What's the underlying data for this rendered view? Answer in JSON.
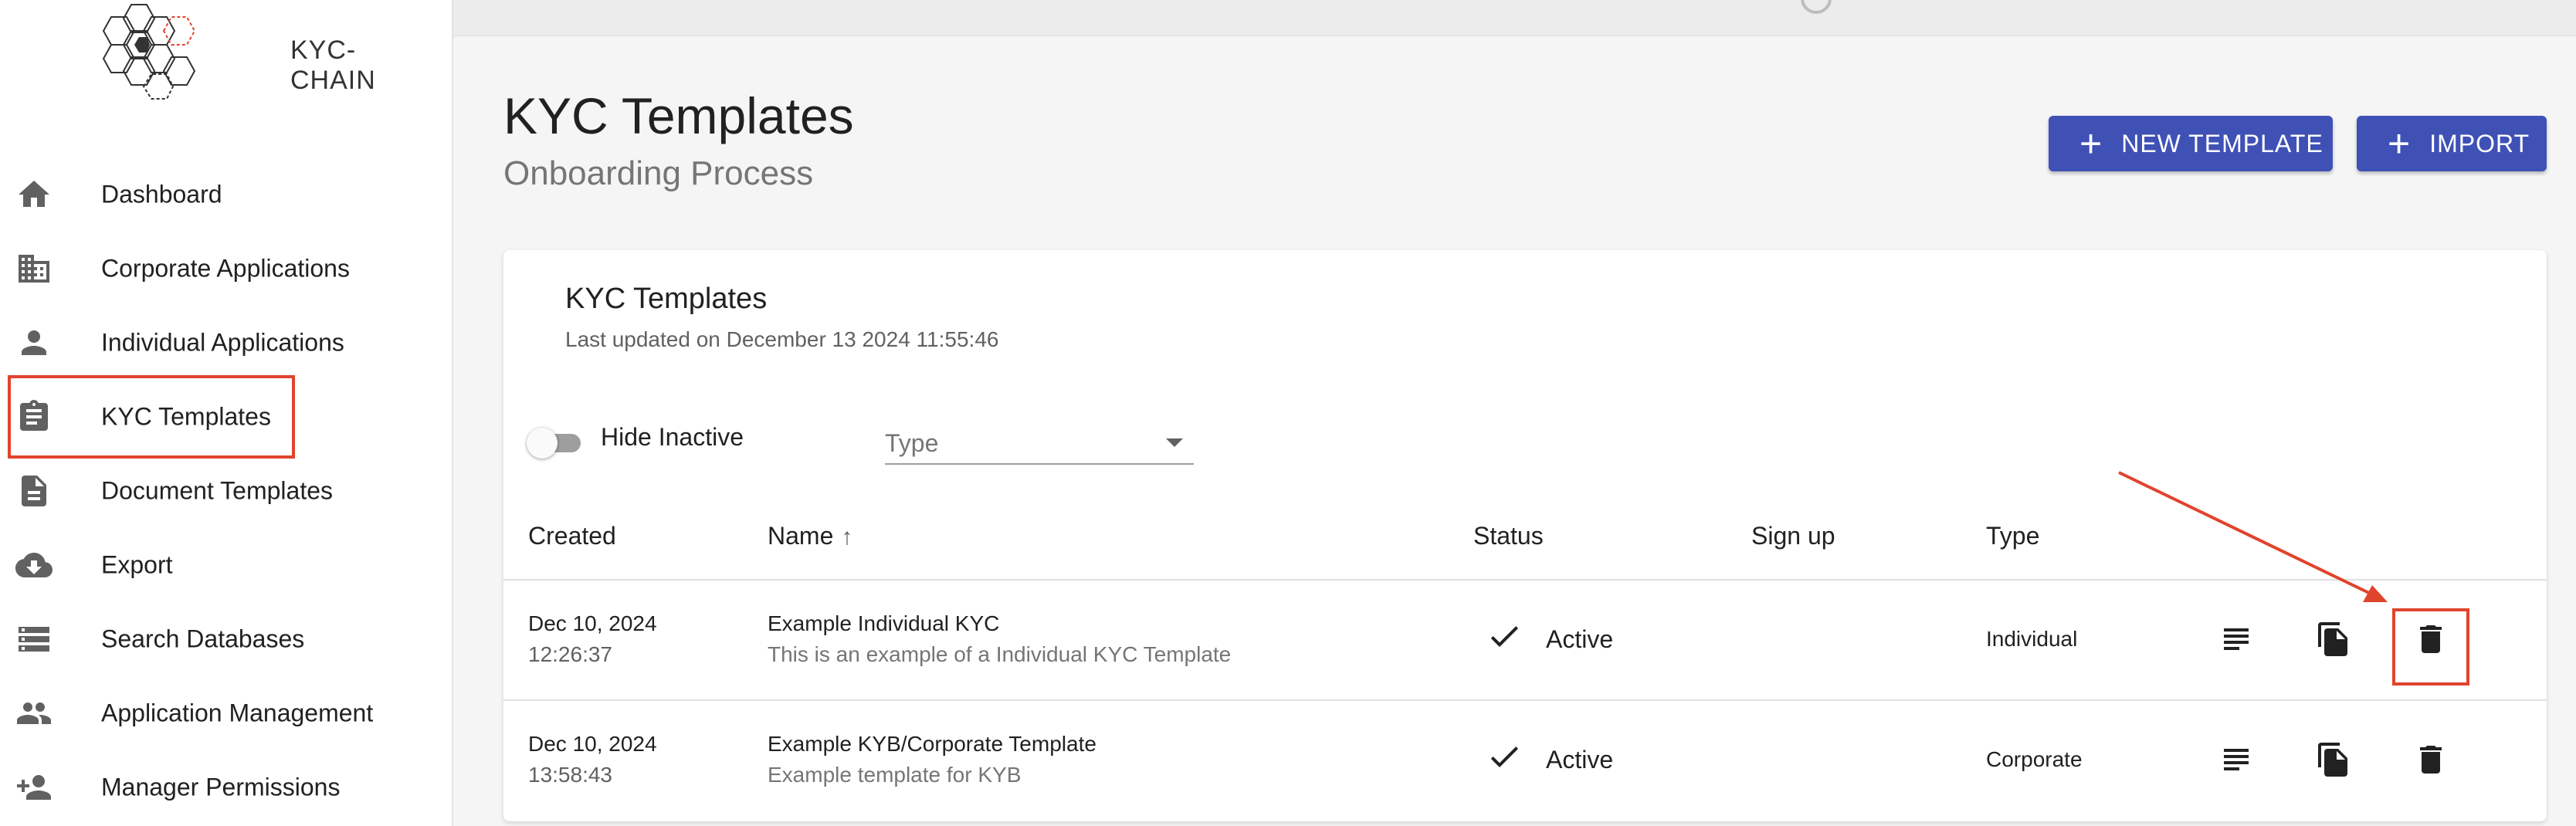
{
  "app": {
    "logo_text": "KYC-CHAIN"
  },
  "sidebar": {
    "items": [
      {
        "label": "Dashboard",
        "icon": "home-icon"
      },
      {
        "label": "Corporate Applications",
        "icon": "building-icon"
      },
      {
        "label": "Individual Applications",
        "icon": "person-icon"
      },
      {
        "label": "KYC Templates",
        "icon": "clipboard-icon",
        "selected": true
      },
      {
        "label": "Document Templates",
        "icon": "document-icon"
      },
      {
        "label": "Export",
        "icon": "cloud-download-icon"
      },
      {
        "label": "Search Databases",
        "icon": "storage-icon"
      },
      {
        "label": "Application Management",
        "icon": "people-icon"
      },
      {
        "label": "Manager Permissions",
        "icon": "person-add-icon"
      }
    ]
  },
  "header": {
    "title": "KYC Templates",
    "subtitle": "Onboarding Process",
    "new_template_label": "NEW TEMPLATE",
    "import_label": "IMPORT"
  },
  "card": {
    "title": "KYC Templates",
    "last_updated": "Last updated on December 13 2024 11:55:46",
    "hide_inactive_label": "Hide Inactive",
    "hide_inactive_on": false,
    "type_placeholder": "Type",
    "columns": {
      "created": "Created",
      "name": "Name",
      "sort_arrow": "↑",
      "status": "Status",
      "signup": "Sign up",
      "type": "Type"
    },
    "rows": [
      {
        "date": "Dec 10, 2024",
        "time": "12:26:37",
        "name": "Example Individual KYC",
        "description": "This is an example of a Individual KYC Template",
        "status": "Active",
        "signup": "",
        "type": "Individual"
      },
      {
        "date": "Dec 10, 2024",
        "time": "13:58:43",
        "name": "Example KYB/Corporate Template",
        "description": "Example template for KYB",
        "status": "Active",
        "signup": "",
        "type": "Corporate"
      }
    ]
  },
  "colors": {
    "primary": "#3f51b5",
    "annotation": "#e0442c"
  }
}
